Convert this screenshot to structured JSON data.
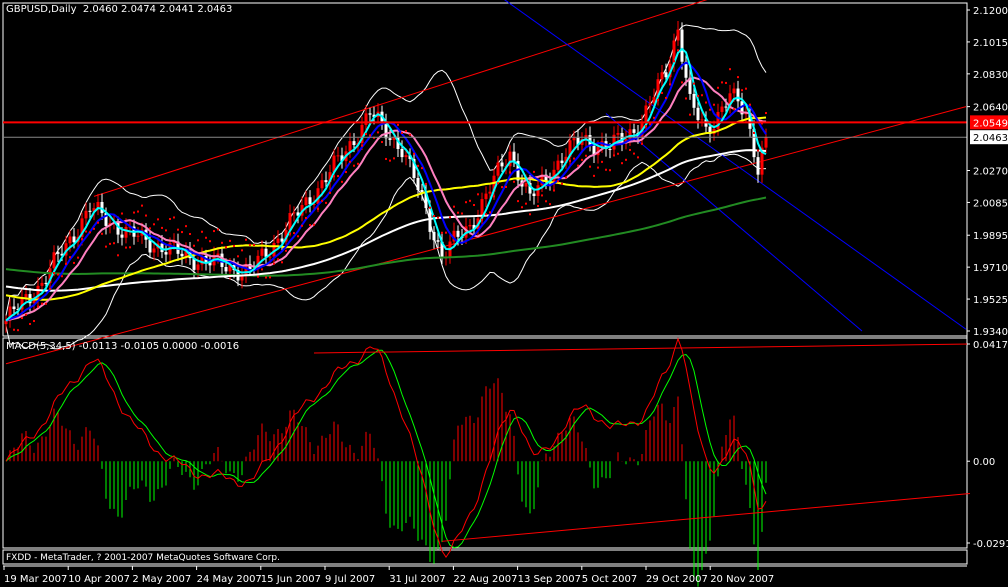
{
  "header": {
    "title": "GBPUSD,Daily",
    "ohlc": "2.0460 2.0474 2.0441 2.0463"
  },
  "macd_header": {
    "title": "MACD(5,34,5)",
    "values": "-0.0113 -0.0105 0.0000 -0.0016"
  },
  "status_bar": "FXDD - MetaTrader, ? 2001-2007 MetaQuotes Software Corp.",
  "colors": {
    "bull": "#ff0000",
    "bear": "#ffffff",
    "sma_fast": "#00ffff",
    "sma_mid": "#0000ff",
    "sma_pink": "#ff80c0",
    "sma_yellow": "#ffff00",
    "sma_white": "#ffffff",
    "sma_green": "#228b22",
    "macd_main": "#ff0000",
    "macd_signal": "#00ff00"
  },
  "chart_data": [
    {
      "type": "candlestick",
      "title": "GBPUSD,Daily",
      "ylim": [
        1.934,
        2.12
      ],
      "yticks": [
        "2.1200",
        "2.1015",
        "2.0830",
        "2.0640",
        "2.0549",
        "2.0463",
        "2.0270",
        "2.0085",
        "1.9895",
        "1.9710",
        "1.9525",
        "1.9340"
      ],
      "xticks": [
        "19 Mar 2007",
        "10 Apr 2007",
        "2 May 2007",
        "24 May 2007",
        "15 Jun 2007",
        "9 Jul 2007",
        "31 Jul 2007",
        "22 Aug 2007",
        "13 Sep 2007",
        "5 Oct 2007",
        "29 Oct 2007",
        "20 Nov 2007"
      ],
      "bars_total": 191,
      "close_waypoints": [
        [
          0,
          1.94
        ],
        [
          9,
          1.962
        ],
        [
          21,
          2.005
        ],
        [
          31,
          1.99
        ],
        [
          44,
          1.978
        ],
        [
          61,
          1.968
        ],
        [
          74,
          2.005
        ],
        [
          84,
          2.035
        ],
        [
          91,
          2.06
        ],
        [
          99,
          2.04
        ],
        [
          104,
          2.01
        ],
        [
          109,
          1.978
        ],
        [
          116,
          1.995
        ],
        [
          126,
          2.038
        ],
        [
          131,
          2.01
        ],
        [
          139,
          2.035
        ],
        [
          144,
          2.045
        ],
        [
          151,
          2.04
        ],
        [
          159,
          2.055
        ],
        [
          165,
          2.085
        ],
        [
          168,
          2.11
        ],
        [
          171,
          2.065
        ],
        [
          175,
          2.05
        ],
        [
          181,
          2.07
        ],
        [
          185,
          2.06
        ],
        [
          188,
          2.03
        ],
        [
          190,
          2.0463
        ]
      ],
      "hlines": [
        {
          "price": 2.0549,
          "label": "2.0549",
          "color": "#ff0000"
        },
        {
          "price": 2.0463,
          "label": "2.0463",
          "color": "#888888"
        }
      ],
      "trendlines": [
        {
          "color": "#ff0000",
          "p1": [
            22,
            2.012
          ],
          "p2": [
            190,
            2.137
          ]
        },
        {
          "color": "#ff0000",
          "p1": [
            0,
            1.915
          ],
          "p2": [
            240,
            2.064
          ]
        },
        {
          "color": "#0000ff",
          "p1": [
            95,
            2.175
          ],
          "p2": [
            240,
            1.935
          ]
        },
        {
          "color": "#0000ff",
          "p1": [
            150,
            2.06
          ],
          "p2": [
            214,
            1.934
          ]
        }
      ]
    },
    {
      "type": "line+bar",
      "title": "MACD(5,34,5)",
      "ylim": [
        -0.0291,
        0.0417
      ],
      "yticks": [
        "0.0417",
        "0.00",
        "-0.0291"
      ],
      "series": [
        {
          "name": "MACD",
          "color": "#ff0000"
        },
        {
          "name": "Signal",
          "color": "#00ff00"
        },
        {
          "name": "Histogram"
        }
      ],
      "trendlines": [
        {
          "color": "#ff0000",
          "p1": [
            77,
            0.0385
          ],
          "p2": [
            241,
            0.0417
          ]
        },
        {
          "color": "#ff0000",
          "p1": [
            109,
            -0.0285
          ],
          "p2": [
            241,
            -0.0115
          ]
        }
      ]
    }
  ]
}
